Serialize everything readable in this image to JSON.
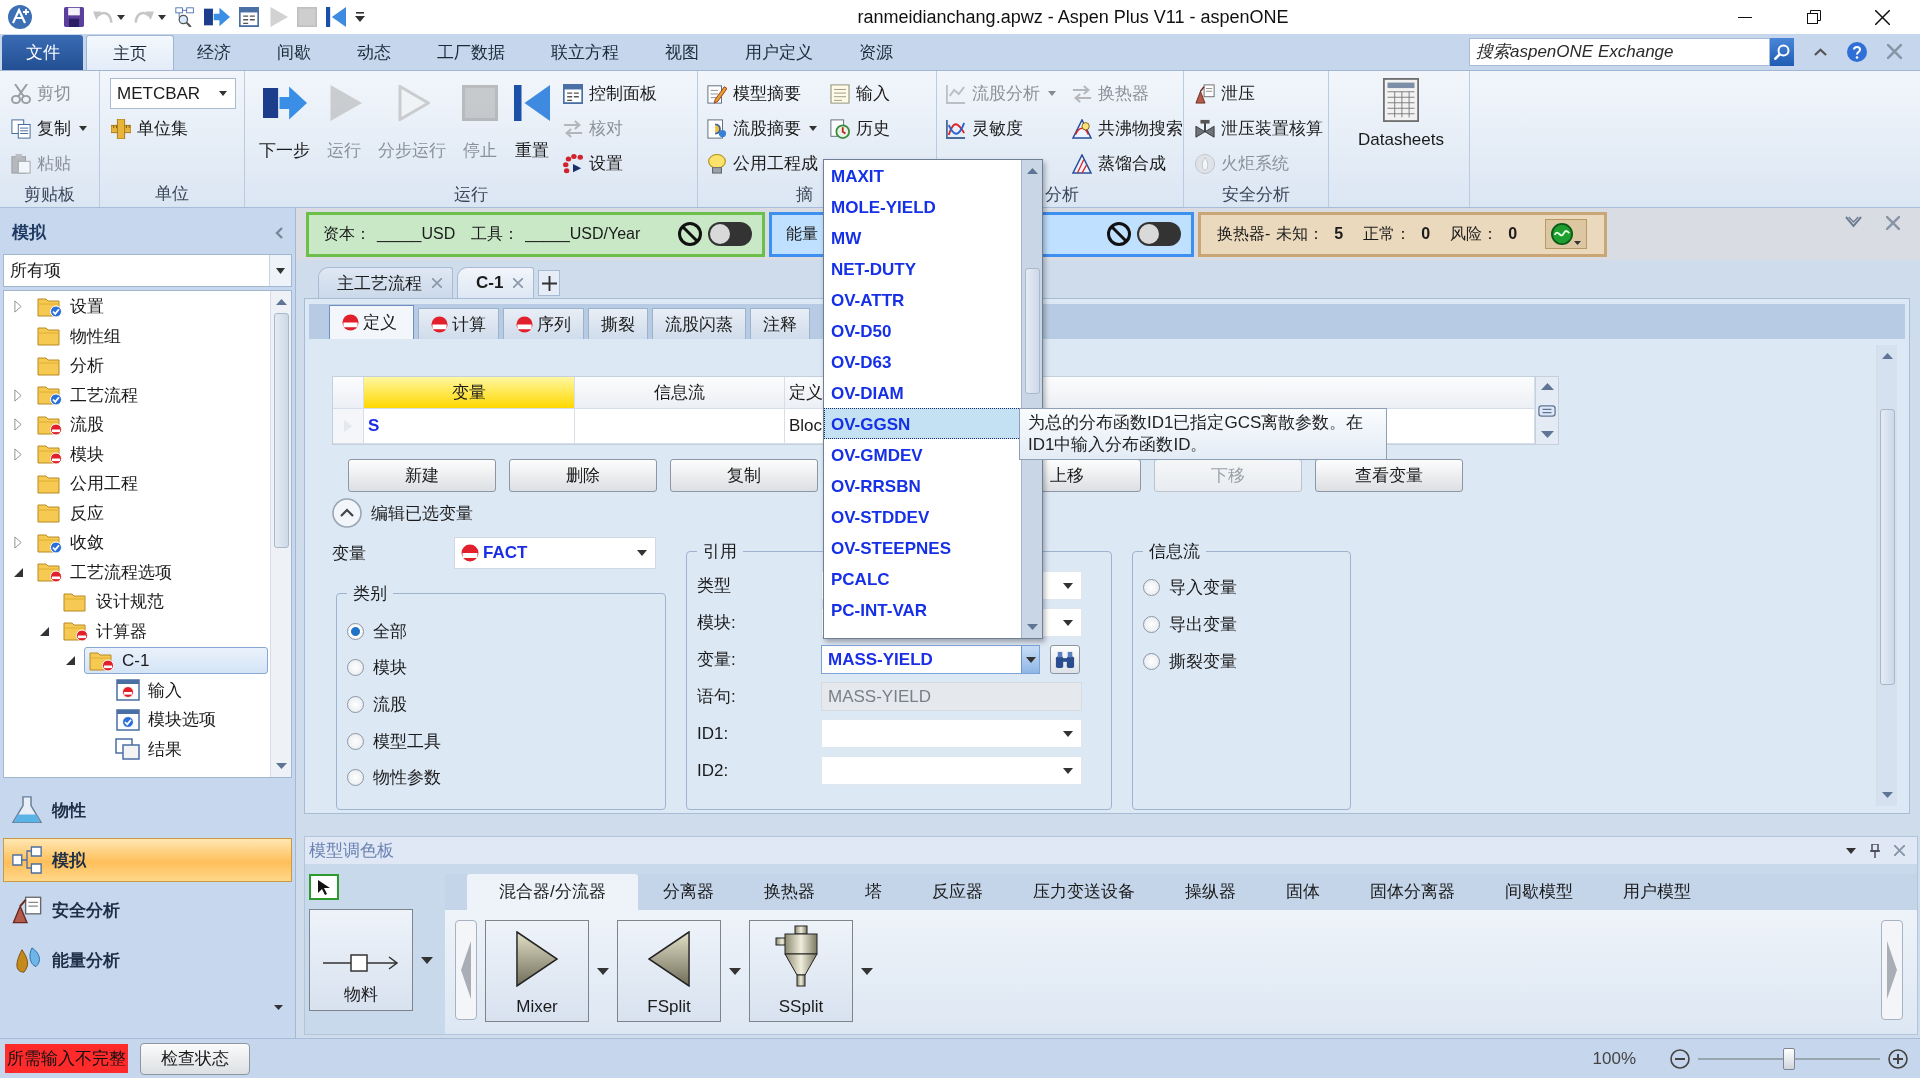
{
  "window": {
    "title": "ranmeidianchang.apwz - Aspen Plus V11 - aspenONE"
  },
  "quick_access": [
    {
      "disabled": false,
      "menu": false
    },
    {
      "disabled": true,
      "menu": true
    },
    {
      "disabled": true,
      "menu": true
    },
    {
      "disabled": false,
      "menu": false
    },
    {
      "disabled": false,
      "menu": false
    },
    {
      "disabled": false,
      "menu": false
    },
    {
      "disabled": true,
      "menu": false
    },
    {
      "disabled": true,
      "menu": false
    },
    {
      "disabled": false,
      "menu": false
    }
  ],
  "menu_tabs": [
    {
      "label": "文件",
      "kind": "file",
      "selected": false
    },
    {
      "label": "主页",
      "kind": "tab",
      "selected": true
    },
    {
      "label": "经济",
      "kind": "tab",
      "selected": false
    },
    {
      "label": "间歇",
      "kind": "tab",
      "selected": false
    },
    {
      "label": "动态",
      "kind": "tab",
      "selected": false
    },
    {
      "label": "工厂数据",
      "kind": "tab",
      "selected": false
    },
    {
      "label": "联立方程",
      "kind": "tab",
      "selected": false
    },
    {
      "label": "视图",
      "kind": "tab",
      "selected": false
    },
    {
      "label": "用户定义",
      "kind": "tab",
      "selected": false
    },
    {
      "label": "资源",
      "kind": "tab",
      "selected": false
    }
  ],
  "search": {
    "placeholder": "搜索aspenONE Exchange"
  },
  "ribbon": {
    "groups": [
      {
        "label": "剪贴板",
        "columns": [
          [
            {
              "kind": "small",
              "label": "剪切",
              "disabled": true,
              "menu": false
            },
            {
              "kind": "small",
              "label": "复制",
              "disabled": false,
              "menu": true
            },
            {
              "kind": "small",
              "label": "粘贴",
              "disabled": true,
              "menu": false
            }
          ]
        ]
      },
      {
        "label": "单位",
        "columns": [
          [
            {
              "kind": "select",
              "value": "METCBAR"
            },
            {
              "kind": "small",
              "label": "单位集",
              "disabled": false,
              "menu": false
            }
          ]
        ]
      },
      {
        "label": "运行",
        "columns": [
          [
            {
              "kind": "large",
              "label": "下一步",
              "disabled": false
            }
          ],
          [
            {
              "kind": "large",
              "label": "运行",
              "disabled": true
            }
          ],
          [
            {
              "kind": "large",
              "label": "分步运行",
              "disabled": true
            }
          ],
          [
            {
              "kind": "large",
              "label": "停止",
              "disabled": true
            }
          ],
          [
            {
              "kind": "large",
              "label": "重置",
              "disabled": false
            }
          ],
          [
            {
              "kind": "small",
              "label": "控制面板",
              "disabled": false,
              "menu": false
            },
            {
              "kind": "small",
              "label": "核对",
              "disabled": true,
              "menu": false
            },
            {
              "kind": "small",
              "label": "设置",
              "disabled": false,
              "menu": false
            }
          ]
        ]
      },
      {
        "label": "摘",
        "columns": [
          [
            {
              "kind": "small",
              "label": "模型摘要",
              "disabled": false,
              "menu": false
            },
            {
              "kind": "small",
              "label": "流股摘要",
              "disabled": false,
              "menu": true
            },
            {
              "kind": "small",
              "label": "公用工程成",
              "disabled": false,
              "menu": false
            }
          ],
          [
            {
              "kind": "small",
              "label": "输入",
              "disabled": false,
              "menu": false
            },
            {
              "kind": "small",
              "label": "历史",
              "disabled": false,
              "menu": false
            }
          ]
        ]
      },
      {
        "label": "分析",
        "columns": [
          [
            {
              "kind": "small",
              "label": "流股分析",
              "disabled": true,
              "menu": true
            },
            {
              "kind": "small",
              "label": "灵敏度",
              "disabled": false,
              "menu": false
            }
          ],
          [
            {
              "kind": "small",
              "label": "换热器",
              "disabled": true,
              "menu": false
            },
            {
              "kind": "small",
              "label": "共沸物搜索",
              "disabled": false,
              "menu": false
            },
            {
              "kind": "small",
              "label": "蒸馏合成",
              "disabled": false,
              "menu": false
            }
          ]
        ]
      },
      {
        "label": "安全分析",
        "columns": [
          [
            {
              "kind": "small",
              "label": "泄压",
              "disabled": false,
              "menu": false
            },
            {
              "kind": "small",
              "label": "泄压装置核算",
              "disabled": false,
              "menu": false
            },
            {
              "kind": "small",
              "label": "火炬系统",
              "disabled": true,
              "menu": false
            }
          ]
        ]
      },
      {
        "columns": [
          [
            {
              "kind": "large",
              "label": "Datasheets",
              "disabled": false
            }
          ]
        ]
      }
    ]
  },
  "navigator": {
    "title": "模拟",
    "filter": "所有项",
    "tree": [
      {
        "label": "设置",
        "kind": "folder",
        "complete": true,
        "error": false,
        "expanded": false,
        "selected": false
      },
      {
        "label": "物性组",
        "kind": "folder",
        "complete": false,
        "error": false,
        "selected": false
      },
      {
        "label": "分析",
        "kind": "folder",
        "complete": false,
        "error": false,
        "selected": false
      },
      {
        "label": "工艺流程",
        "kind": "folder",
        "complete": true,
        "error": false,
        "expanded": false,
        "selected": false
      },
      {
        "label": "流股",
        "kind": "folder",
        "complete": false,
        "error": true,
        "expanded": false,
        "selected": false
      },
      {
        "label": "模块",
        "kind": "folder",
        "complete": false,
        "error": true,
        "expanded": false,
        "selected": false
      },
      {
        "label": "公用工程",
        "kind": "folder",
        "complete": false,
        "error": false,
        "selected": false
      },
      {
        "label": "反应",
        "kind": "folder",
        "complete": false,
        "error": false,
        "selected": false
      },
      {
        "label": "收敛",
        "kind": "folder",
        "complete": true,
        "error": false,
        "expanded": false,
        "selected": false
      },
      {
        "label": "工艺流程选项",
        "kind": "folder",
        "complete": false,
        "error": true,
        "expanded": true,
        "selected": false,
        "children": [
          {
            "label": "设计规范",
            "kind": "folder",
            "complete": false,
            "error": false,
            "selected": false
          },
          {
            "label": "计算器",
            "kind": "folder",
            "complete": false,
            "error": true,
            "expanded": true,
            "selected": false,
            "children": [
              {
                "label": "C-1",
                "kind": "folder",
                "complete": false,
                "error": true,
                "expanded": true,
                "selected": true,
                "children": [
                  {
                    "label": "输入",
                    "kind": "form",
                    "complete": false,
                    "error": true,
                    "selected": false
                  },
                  {
                    "label": "模块选项",
                    "kind": "form",
                    "complete": true,
                    "error": false,
                    "selected": false
                  },
                  {
                    "label": "结果",
                    "kind": "results",
                    "complete": false,
                    "error": false,
                    "selected": false
                  }
                ]
              }
            ]
          }
        ]
      }
    ],
    "panes": [
      {
        "label": "物性",
        "selected": false
      },
      {
        "label": "模拟",
        "selected": true
      },
      {
        "label": "安全分析",
        "selected": false
      },
      {
        "label": "能量分析",
        "selected": false
      }
    ]
  },
  "cost_bar": {
    "capital_label": "资本：",
    "capital_value": "_____USD",
    "utility_label": "工具：",
    "utility_value": "_____USD/Year",
    "on": false
  },
  "energy_bar": {
    "label": "能量",
    "on": false
  },
  "exchanger_bar": {
    "label": "换热器-",
    "unknown_label": "未知：",
    "unknown": "5",
    "normal_label": "正常：",
    "normal": "0",
    "risk_label": "风险：",
    "risk": "0"
  },
  "document_tabs": [
    {
      "label": "主工艺流程",
      "selected": false
    },
    {
      "label": "C-1",
      "selected": true
    }
  ],
  "form": {
    "tabs": [
      {
        "label": "定义",
        "error": true,
        "selected": true
      },
      {
        "label": "计算",
        "error": true,
        "selected": false
      },
      {
        "label": "序列",
        "error": true,
        "selected": false
      },
      {
        "label": "撕裂",
        "error": false,
        "selected": false
      },
      {
        "label": "流股闪蒸",
        "error": false,
        "selected": false
      },
      {
        "label": "注释",
        "error": false,
        "selected": false
      }
    ],
    "grid": {
      "columns": [
        {
          "label": "变量",
          "selected": true
        },
        {
          "label": "信息流",
          "selected": false
        },
        {
          "label": "定义",
          "selected": false
        }
      ],
      "rows": [
        {
          "variable": "S",
          "definition": "Bloc"
        }
      ]
    },
    "buttons": [
      {
        "label": "新建",
        "disabled": false
      },
      {
        "label": "删除",
        "disabled": false
      },
      {
        "label": "复制",
        "disabled": false
      },
      {
        "label": "上移",
        "disabled": false
      },
      {
        "label": "下移",
        "disabled": true
      },
      {
        "label": "查看变量",
        "disabled": false
      }
    ],
    "edit_section": {
      "label": "编辑已选变量",
      "expanded": true
    },
    "variable": {
      "label": "变量",
      "value": "FACT",
      "error": true
    },
    "category": {
      "title": "类别",
      "options": [
        {
          "label": "全部",
          "selected": true
        },
        {
          "label": "模块",
          "selected": false
        },
        {
          "label": "流股",
          "selected": false
        },
        {
          "label": "模型工具",
          "selected": false
        },
        {
          "label": "物性参数",
          "selected": false
        }
      ]
    },
    "reference": {
      "title": "引用",
      "fields": [
        {
          "label": "类型",
          "kind": "select"
        },
        {
          "label": "模块:",
          "kind": "select"
        },
        {
          "label": "变量:",
          "kind": "combo",
          "value": "MASS-YIELD"
        },
        {
          "label": "语句:",
          "kind": "text",
          "value": "MASS-YIELD",
          "disabled": true
        },
        {
          "label": "ID1:",
          "kind": "select"
        },
        {
          "label": "ID2:",
          "kind": "select"
        }
      ]
    },
    "info_flow": {
      "title": "信息流",
      "options": [
        {
          "label": "导入变量",
          "selected": false
        },
        {
          "label": "导出变量",
          "selected": false
        },
        {
          "label": "撕裂变量",
          "selected": false
        }
      ]
    }
  },
  "dropdown_list": {
    "items": [
      {
        "label": "MAXIT",
        "selected": false
      },
      {
        "label": "MOLE-YIELD",
        "selected": false
      },
      {
        "label": "MW",
        "selected": false
      },
      {
        "label": "NET-DUTY",
        "selected": false
      },
      {
        "label": "OV-ATTR",
        "selected": false
      },
      {
        "label": "OV-D50",
        "selected": false
      },
      {
        "label": "OV-D63",
        "selected": false
      },
      {
        "label": "OV-DIAM",
        "selected": false
      },
      {
        "label": "OV-GGSN",
        "selected": true
      },
      {
        "label": "OV-GMDEV",
        "selected": false
      },
      {
        "label": "OV-RRSBN",
        "selected": false
      },
      {
        "label": "OV-STDDEV",
        "selected": false
      },
      {
        "label": "OV-STEEPNES",
        "selected": false
      },
      {
        "label": "PCALC",
        "selected": false
      },
      {
        "label": "PC-INT-VAR",
        "selected": false
      }
    ]
  },
  "tooltip": {
    "text": "为总的分布函数ID1已指定GCS离散参数。在ID1中输入分布函数ID。"
  },
  "palette": {
    "title": "模型调色板",
    "tabs": [
      {
        "label": "混合器/分流器",
        "selected": true
      },
      {
        "label": "分离器",
        "selected": false
      },
      {
        "label": "换热器",
        "selected": false
      },
      {
        "label": "塔",
        "selected": false
      },
      {
        "label": "反应器",
        "selected": false
      },
      {
        "label": "压力变送设备",
        "selected": false
      },
      {
        "label": "操纵器",
        "selected": false
      },
      {
        "label": "固体",
        "selected": false
      },
      {
        "label": "固体分离器",
        "selected": false
      },
      {
        "label": "间歇模型",
        "selected": false
      },
      {
        "label": "用户模型",
        "selected": false
      }
    ],
    "stream": {
      "label": "物料"
    },
    "models": [
      {
        "label": "Mixer"
      },
      {
        "label": "FSplit"
      },
      {
        "label": "SSplit"
      }
    ]
  },
  "status_bar": {
    "message": "所需输入不完整",
    "check_button": "检查状态",
    "zoom": "100%",
    "zoom_slider": {
      "level": 0.5
    }
  }
}
